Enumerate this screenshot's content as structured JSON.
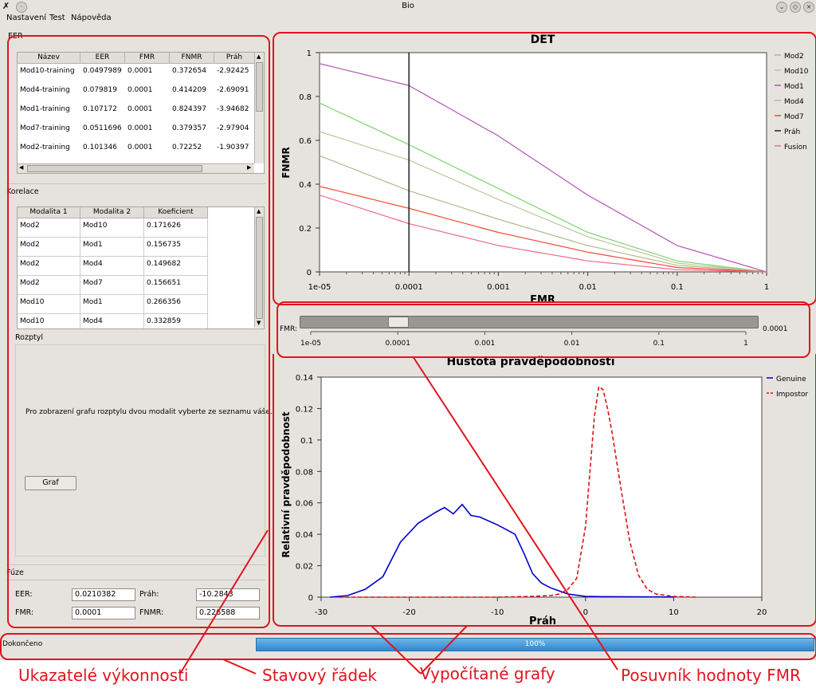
{
  "window": {
    "title": "Bio"
  },
  "menu": [
    "Nastavení",
    "Test",
    "Nápověda"
  ],
  "eer": {
    "label": "EER",
    "columns": [
      "Název",
      "EER",
      "FMR",
      "FNMR",
      "Práh"
    ],
    "rows": [
      [
        "Mod10-training",
        "0.0497989",
        "0.0001",
        "0.372654",
        "-2.92425"
      ],
      [
        "Mod4-training",
        "0.079819",
        "0.0001",
        "0.414209",
        "-2.69091"
      ],
      [
        "Mod1-training",
        "0.107172",
        "0.0001",
        "0.824397",
        "-3.94682"
      ],
      [
        "Mod7-training",
        "0.0511696",
        "0.0001",
        "0.379357",
        "-2.97904"
      ],
      [
        "Mod2-training",
        "0.101346",
        "0.0001",
        "0.72252",
        "-1.90397"
      ]
    ]
  },
  "korelace": {
    "label": "Korelace",
    "columns": [
      "Modalita 1",
      "Modalita 2",
      "Koeficient"
    ],
    "rows": [
      [
        "Mod2",
        "Mod10",
        "0.171626"
      ],
      [
        "Mod2",
        "Mod1",
        "0.156735"
      ],
      [
        "Mod2",
        "Mod4",
        "0.149682"
      ],
      [
        "Mod2",
        "Mod7",
        "0.156651"
      ],
      [
        "Mod10",
        "Mod1",
        "0.266356"
      ],
      [
        "Mod10",
        "Mod4",
        "0.332859"
      ]
    ]
  },
  "rozptyl": {
    "label": "Rozptyl",
    "message": "Pro zobrazení grafu rozptylu dvou modalit vyberte ze seznamu váše.",
    "button": "Graf"
  },
  "fuze": {
    "label": "Fúze",
    "eer_label": "EER:",
    "eer_value": "0.0210382",
    "prah_label": "Práh:",
    "prah_value": "-10.2843",
    "fmr_label": "FMR:",
    "fmr_value": "0.0001",
    "fnmr_label": "FNMR:",
    "fnmr_value": "0.226588"
  },
  "slider": {
    "label": "FMR:",
    "value": "0.0001",
    "ticks": [
      "1e-05",
      "0.0001",
      "0.001",
      "0.01",
      "0.1",
      "1"
    ]
  },
  "status": {
    "text": "Dokončeno",
    "progress": "100%"
  },
  "annotations": {
    "ukazatele": "Ukazatelé výkonnosti",
    "stavovy": "Stavový řádek",
    "grafy": "Vypočítané grafy",
    "posuvnik": "Posuvník hodnoty FMR"
  },
  "colors": {
    "Mod2": "#7fd36f",
    "Mod10": "#bcc79a",
    "Mod1": "#b455b4",
    "Mod4": "#b2b98c",
    "Mod7": "#ee4a34",
    "Prah": "#222222",
    "Fusion": "#f06a8c",
    "Genuine": "#0000cc",
    "Impostor": "#dd1111",
    "annotation": "#e0141e"
  },
  "chart_data": [
    {
      "type": "line",
      "title": "DET",
      "xlabel": "FMR",
      "ylabel": "FNMR",
      "xscale": "log",
      "xlim": [
        1e-05,
        1
      ],
      "ylim": [
        0,
        1
      ],
      "xticks": [
        "1e-05",
        "0.0001",
        "0.001",
        "0.01",
        "0.1",
        "1"
      ],
      "yticks": [
        "0",
        "0.2",
        "0.4",
        "0.6",
        "0.8",
        "1"
      ],
      "legend": "right",
      "threshold_x": 0.0001,
      "x": [
        1e-05,
        0.0001,
        0.001,
        0.01,
        0.1,
        1
      ],
      "series": [
        {
          "name": "Mod2",
          "values": [
            0.77,
            0.58,
            0.38,
            0.18,
            0.05,
            0.0
          ]
        },
        {
          "name": "Mod10",
          "values": [
            0.64,
            0.51,
            0.33,
            0.16,
            0.04,
            0.0
          ]
        },
        {
          "name": "Mod1",
          "values": [
            0.95,
            0.85,
            0.62,
            0.35,
            0.12,
            0.0
          ]
        },
        {
          "name": "Mod4",
          "values": [
            0.53,
            0.37,
            0.24,
            0.12,
            0.03,
            0.0
          ]
        },
        {
          "name": "Mod7",
          "values": [
            0.39,
            0.29,
            0.18,
            0.09,
            0.02,
            0.0
          ]
        },
        {
          "name": "Práh",
          "values": []
        },
        {
          "name": "Fusion",
          "values": [
            0.35,
            0.22,
            0.12,
            0.05,
            0.01,
            0.0
          ]
        }
      ]
    },
    {
      "type": "line",
      "title": "Hustota pravděpodobnosti",
      "xlabel": "Práh",
      "ylabel": "Relativní pravděpodobnost",
      "xlim": [
        -30,
        20
      ],
      "ylim": [
        0,
        0.14
      ],
      "xticks": [
        "-30",
        "-20",
        "-10",
        "0",
        "10",
        "20"
      ],
      "yticks": [
        "0",
        "0.02",
        "0.04",
        "0.06",
        "0.08",
        "0.1",
        "0.12",
        "0.14"
      ],
      "legend": "right",
      "series": [
        {
          "name": "Genuine",
          "x": [
            -29,
            -27,
            -25,
            -23,
            -21,
            -19,
            -17,
            -16,
            -15,
            -14,
            -13,
            -12,
            -10,
            -9,
            -8,
            -7,
            -6,
            -5,
            -4,
            -3,
            -2,
            0,
            2,
            5,
            10
          ],
          "values": [
            0,
            0.001,
            0.005,
            0.013,
            0.035,
            0.047,
            0.054,
            0.057,
            0.053,
            0.059,
            0.052,
            0.051,
            0.046,
            0.043,
            0.04,
            0.028,
            0.015,
            0.009,
            0.006,
            0.004,
            0.002,
            0.0005,
            0.0003,
            0.0002,
            0.0001
          ]
        },
        {
          "name": "Impostor",
          "x": [
            -28,
            -10,
            -6,
            -4,
            -3,
            -2,
            -1,
            0,
            0.5,
            1,
            1.5,
            2,
            2.5,
            3,
            4,
            5,
            6,
            7,
            8,
            10,
            12.5
          ],
          "values": [
            0,
            0,
            0.0005,
            0.001,
            0.002,
            0.005,
            0.012,
            0.045,
            0.08,
            0.115,
            0.134,
            0.132,
            0.12,
            0.105,
            0.07,
            0.036,
            0.014,
            0.005,
            0.002,
            0.0005,
            0
          ]
        }
      ]
    }
  ]
}
